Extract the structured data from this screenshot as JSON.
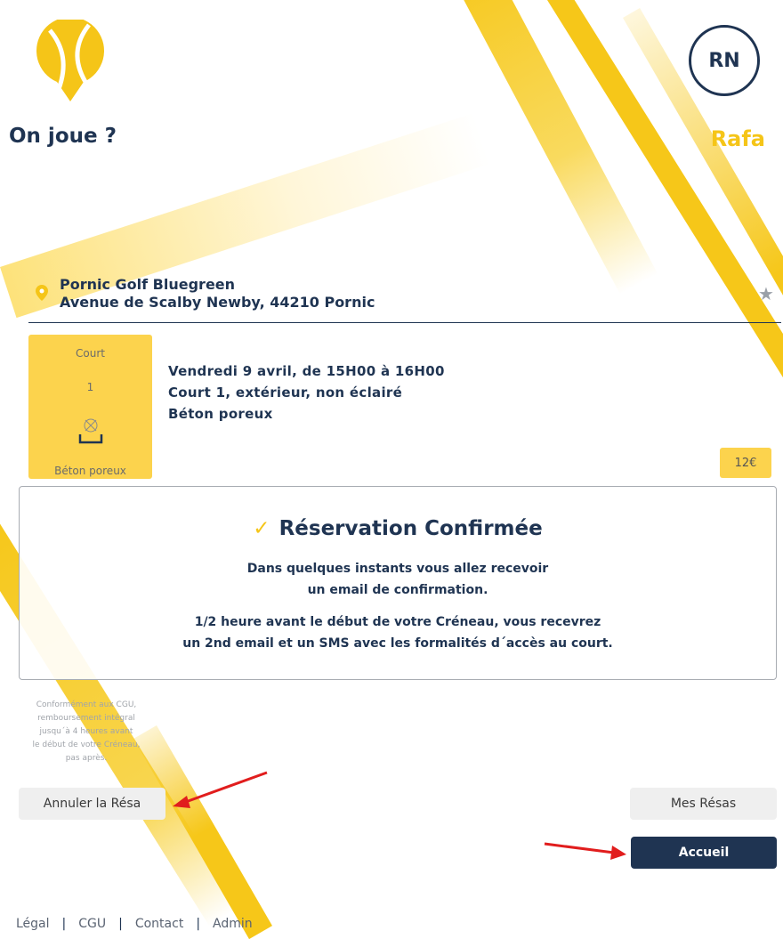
{
  "header": {
    "title": "On joue ?",
    "avatar_initials": "RN",
    "user_name": "Rafa"
  },
  "club": {
    "name": "Pornic Golf Bluegreen",
    "address": "Avenue de Scalby Newby, 44210 Pornic"
  },
  "court_card": {
    "label": "Court",
    "number": "1",
    "surface": "Béton poreux"
  },
  "details": {
    "line1": "Vendredi 9 avril, de 15H00 à 16H00",
    "line2": "Court 1, extérieur, non éclairé",
    "line3": "Béton poreux"
  },
  "price": "12€",
  "confirmation": {
    "check": "✓",
    "title": "Réservation Confirmée",
    "p1_line1": "Dans quelques instants vous allez recevoir",
    "p1_line2": "un email de confirmation.",
    "p2_line1": "1/2 heure avant le début de votre Créneau, vous recevrez",
    "p2_line2": "un 2nd email et un SMS avec les formalités d´accès au court."
  },
  "refund_note": {
    "l1": "Conformément aux CGU,",
    "l2": "remboursement intégral",
    "l3": "jusqu´à 4 heures avant",
    "l4": "le début de votre Créneau,",
    "l5": "pas après."
  },
  "buttons": {
    "cancel": "Annuler la Résa",
    "mes_resas": "Mes Résas",
    "home": "Accueil"
  },
  "footer": {
    "legal": "Légal",
    "cgu": "CGU",
    "contact": "Contact",
    "admin": "Admin",
    "separator": "|"
  },
  "colors": {
    "navy": "#1f3452",
    "yellow": "#f5c518",
    "arrow": "#e11d1d"
  },
  "icons": [
    "tennis-ball-pin-logo",
    "location-pin-icon",
    "star-icon",
    "light-bulb-off-icon",
    "check-icon"
  ]
}
